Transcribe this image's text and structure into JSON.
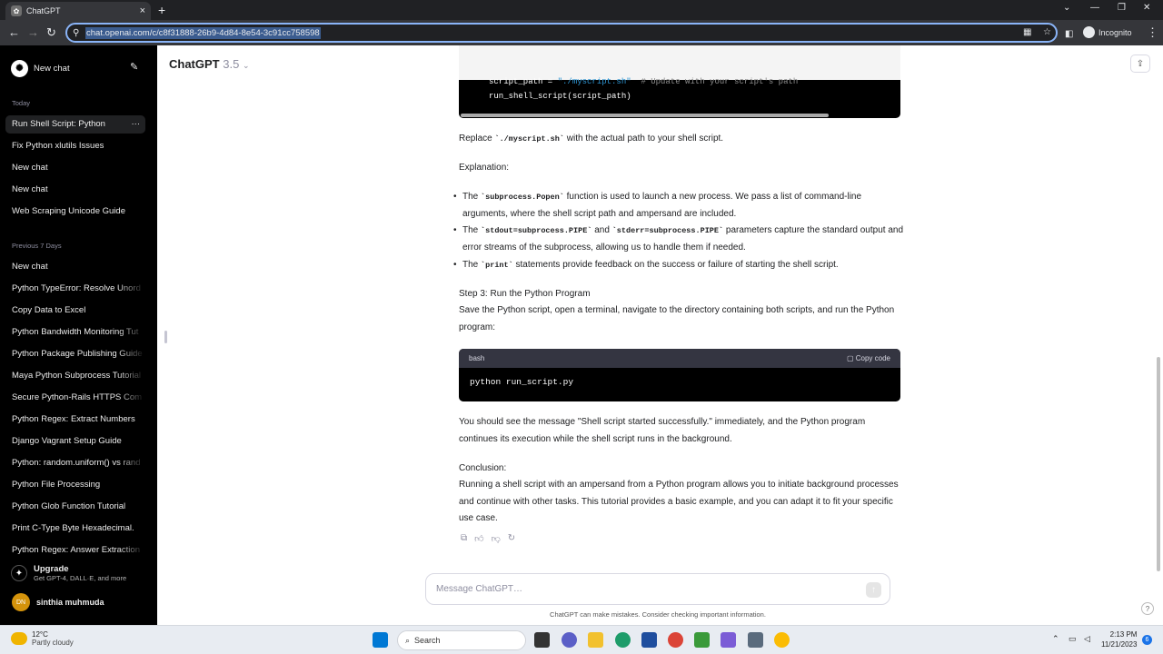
{
  "browser": {
    "tab_title": "ChatGPT",
    "url": "chat.openai.com/c/c8f31888-26b9-4d84-8e54-3c91cc758598",
    "profile": "Incognito"
  },
  "sidebar": {
    "new_chat": "New chat",
    "section_today": "Today",
    "today": [
      "Run Shell Script: Python",
      "Fix Python xlutils Issues",
      "New chat",
      "New chat",
      "Web Scraping Unicode Guide"
    ],
    "section_prev": "Previous 7 Days",
    "previous": [
      "New chat",
      "Python TypeError: Resolve Unord",
      "Copy Data to Excel",
      "Python Bandwidth Monitoring Tut",
      "Python Package Publishing Guide",
      "Maya Python Subprocess Tutorial",
      "Secure Python-Rails HTTPS Com",
      "Python Regex: Extract Numbers",
      "Django Vagrant Setup Guide",
      "Python: random.uniform() vs rand",
      "Python File Processing",
      "Python Glob Function Tutorial",
      "Print C-Type Byte Hexadecimal.",
      "Python Regex: Answer Extraction"
    ],
    "upgrade_title": "Upgrade",
    "upgrade_sub": "Get GPT-4, DALL·E, and more",
    "user_initials": "DN",
    "user_name": "sinthia muhmuda"
  },
  "header": {
    "title": "ChatGPT",
    "version": "3.5"
  },
  "content": {
    "code1_line1_a": "script_path = ",
    "code1_line1_str": "\"./myscript.sh\"",
    "code1_line1_cm": "  # Update with your script's path",
    "code1_line2": "run_shell_script(script_path)",
    "replace_a": "Replace ",
    "replace_code": "`./myscript.sh`",
    "replace_b": " with the actual path to your shell script.",
    "explanation": "Explanation:",
    "b1_a": "The ",
    "b1_code": "`subprocess.Popen`",
    "b1_b": " function is used to launch a new process. We pass a list of command-line arguments, where the shell script path and ampersand are included.",
    "b2_a": "The ",
    "b2_code1": "`stdout=subprocess.PIPE`",
    "b2_mid": " and ",
    "b2_code2": "`stderr=subprocess.PIPE`",
    "b2_b": " parameters capture the standard output and error streams of the subprocess, allowing us to handle them if needed.",
    "b3_a": "The ",
    "b3_code": "`print`",
    "b3_b": " statements provide feedback on the success or failure of starting the shell script.",
    "step3": "Step 3: Run the Python Program",
    "step3_text": "Save the Python script, open a terminal, navigate to the directory containing both scripts, and run the Python program:",
    "code2_lang": "bash",
    "code2_copy": "Copy code",
    "code2_body": "python run_script.py",
    "result": "You should see the message \"Shell script started successfully.\" immediately, and the Python program continues its execution while the shell script runs in the background.",
    "conclusion": "Conclusion:",
    "conclusion_text": "Running a shell script with an ampersand from a Python program allows you to initiate background processes and continue with other tasks. This tutorial provides a basic example, and you can adapt it to fit your specific use case."
  },
  "composer": {
    "placeholder": "Message ChatGPT…",
    "disclaimer": "ChatGPT can make mistakes. Consider checking important information."
  },
  "taskbar": {
    "temp": "12°C",
    "weather": "Partly cloudy",
    "search": "Search",
    "time": "2:13 PM",
    "date": "11/21/2023",
    "notifications": "6"
  }
}
